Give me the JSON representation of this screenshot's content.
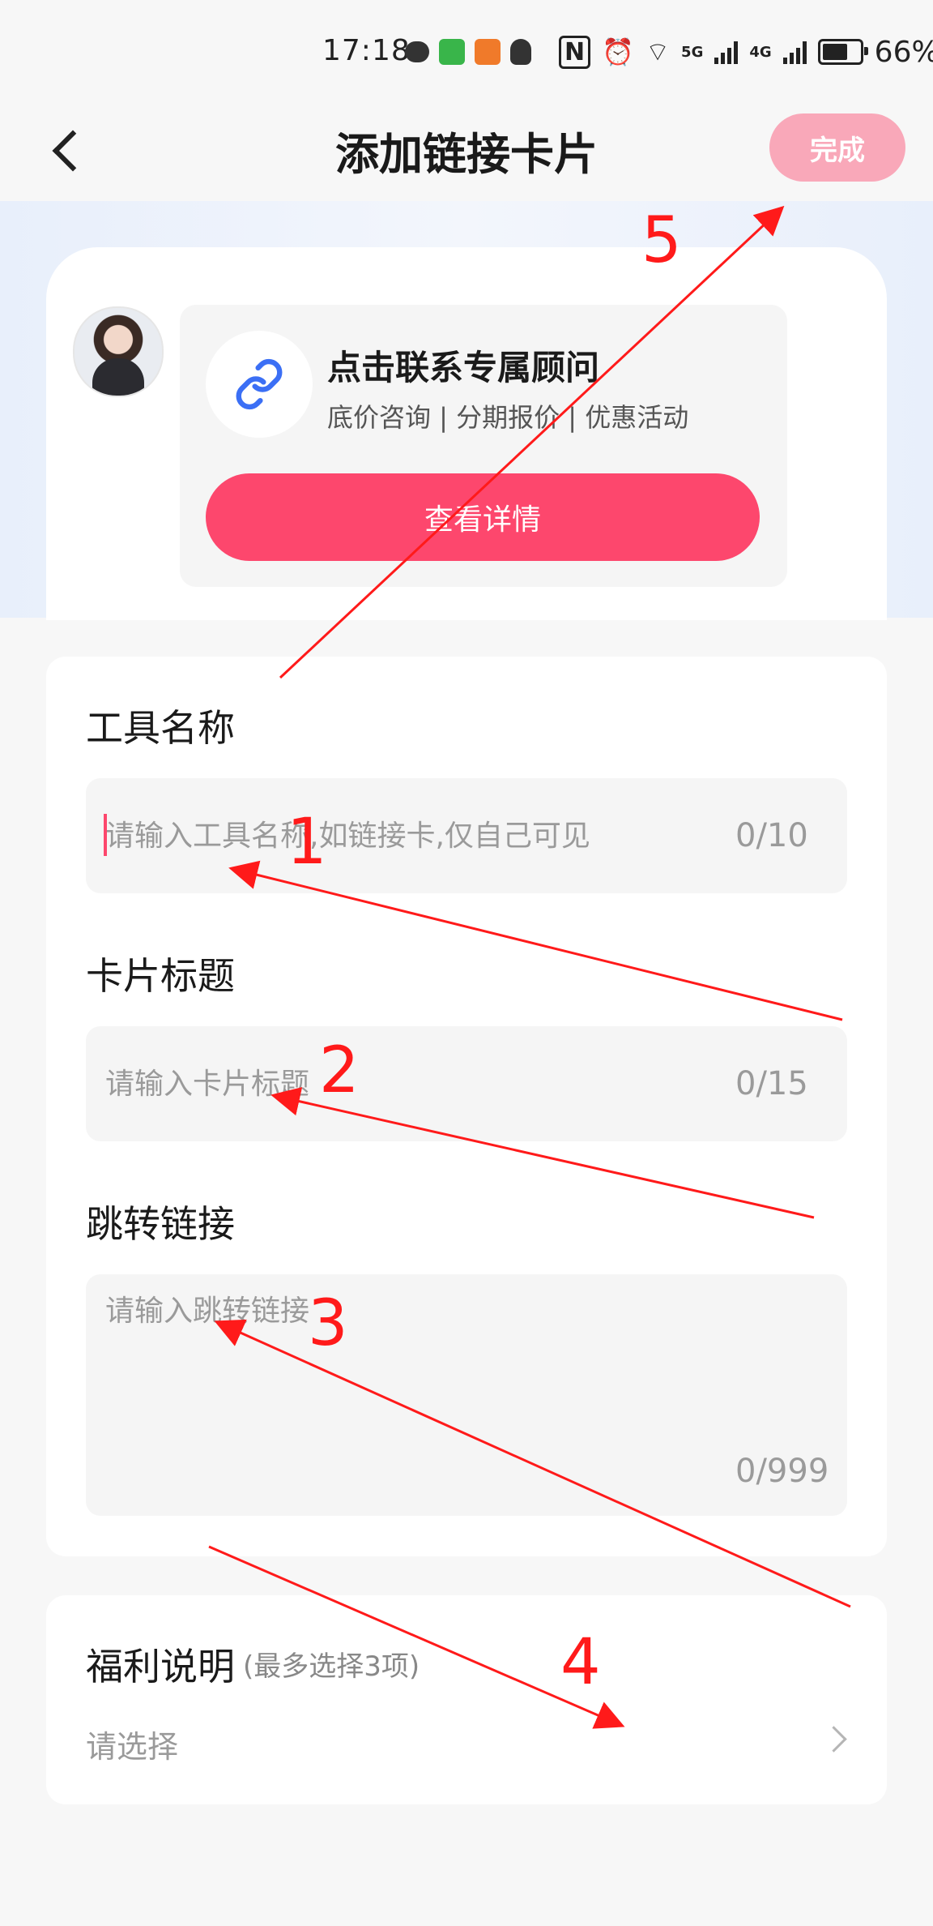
{
  "status_bar": {
    "time": "17:18",
    "battery": "66%",
    "network_5g": "5G",
    "network_4g": "4G"
  },
  "nav": {
    "title": "添加链接卡片",
    "done_label": "完成"
  },
  "preview": {
    "card_title": "点击联系专属顾问",
    "card_subtitle": "底价咨询 | 分期报价 | 优惠活动",
    "button_label": "查看详情"
  },
  "form": {
    "tool_name": {
      "label": "工具名称",
      "placeholder": "请输入工具名称,如链接卡,仅自己可见",
      "value": "",
      "counter": "0/10"
    },
    "card_title": {
      "label": "卡片标题",
      "placeholder": "请输入卡片标题",
      "value": "",
      "counter": "0/15"
    },
    "jump_link": {
      "label": "跳转链接",
      "placeholder": "请输入跳转链接",
      "value": "",
      "counter": "0/999"
    }
  },
  "benefits": {
    "label": "福利说明",
    "note": "(最多选择3项)",
    "placeholder": "请选择"
  },
  "annotations": [
    "1",
    "2",
    "3",
    "4",
    "5"
  ],
  "colors": {
    "accent": "#fd476d",
    "done_disabled": "#f9a8b9",
    "annotation": "#ff1a1a",
    "link_icon": "#3b6ff5"
  }
}
